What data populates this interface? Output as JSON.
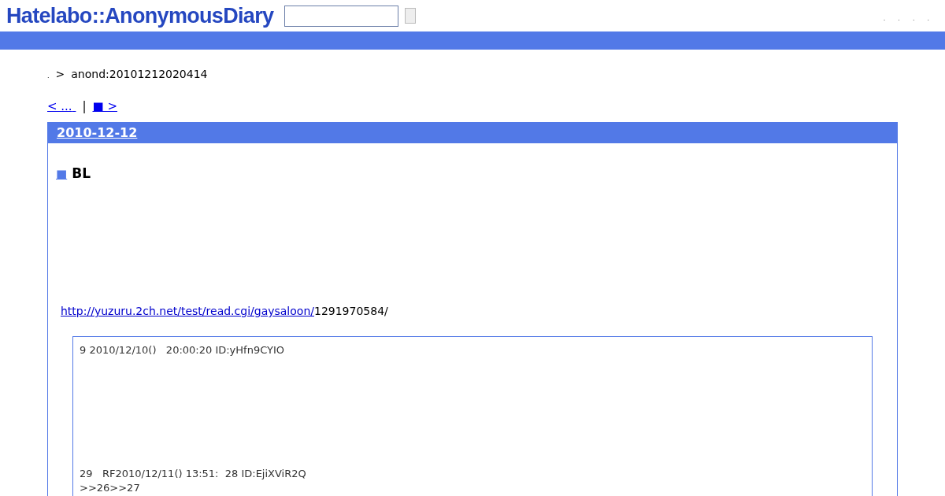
{
  "header": {
    "logo": "Hatelabo::AnonymousDiary",
    "top_links": [
      ".",
      ".",
      ".",
      "."
    ]
  },
  "breadcrumb": {
    "mark": ".",
    "arrow": ">",
    "text": "anond:20101212020414"
  },
  "nav": {
    "prev": "< ...",
    "separator": "|",
    "next": "■ >"
  },
  "day": {
    "date": "2010-12-12",
    "section": {
      "marker": "■",
      "title": "BL"
    },
    "url": "http://yuzuru.2ch.net/test/read.cgi/gaysaloon/",
    "url_tail": "1291970584/",
    "quote": {
      "first_post": "9 2010/12/10()   20:00:20 ID:yHfn9CYIO",
      "second_post": "29   RF2010/12/11() 13:51:  28 ID:EjiXViR2Q",
      "reply": ">>26>>27"
    }
  }
}
